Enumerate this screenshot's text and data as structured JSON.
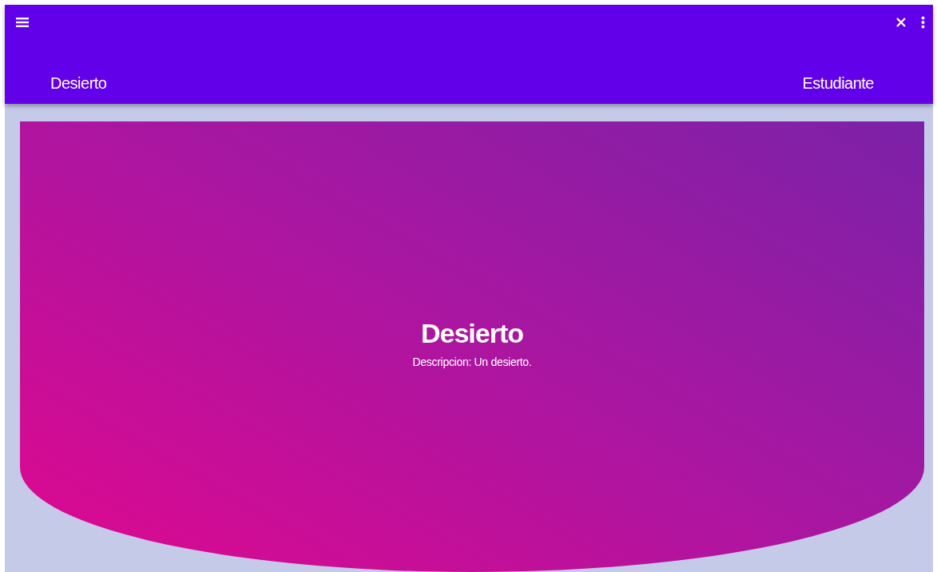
{
  "app_bar": {
    "title": "Desierto",
    "user_label": "Estudiante"
  },
  "hero": {
    "title": "Desierto",
    "description": "Descripcion: Un desierto."
  }
}
